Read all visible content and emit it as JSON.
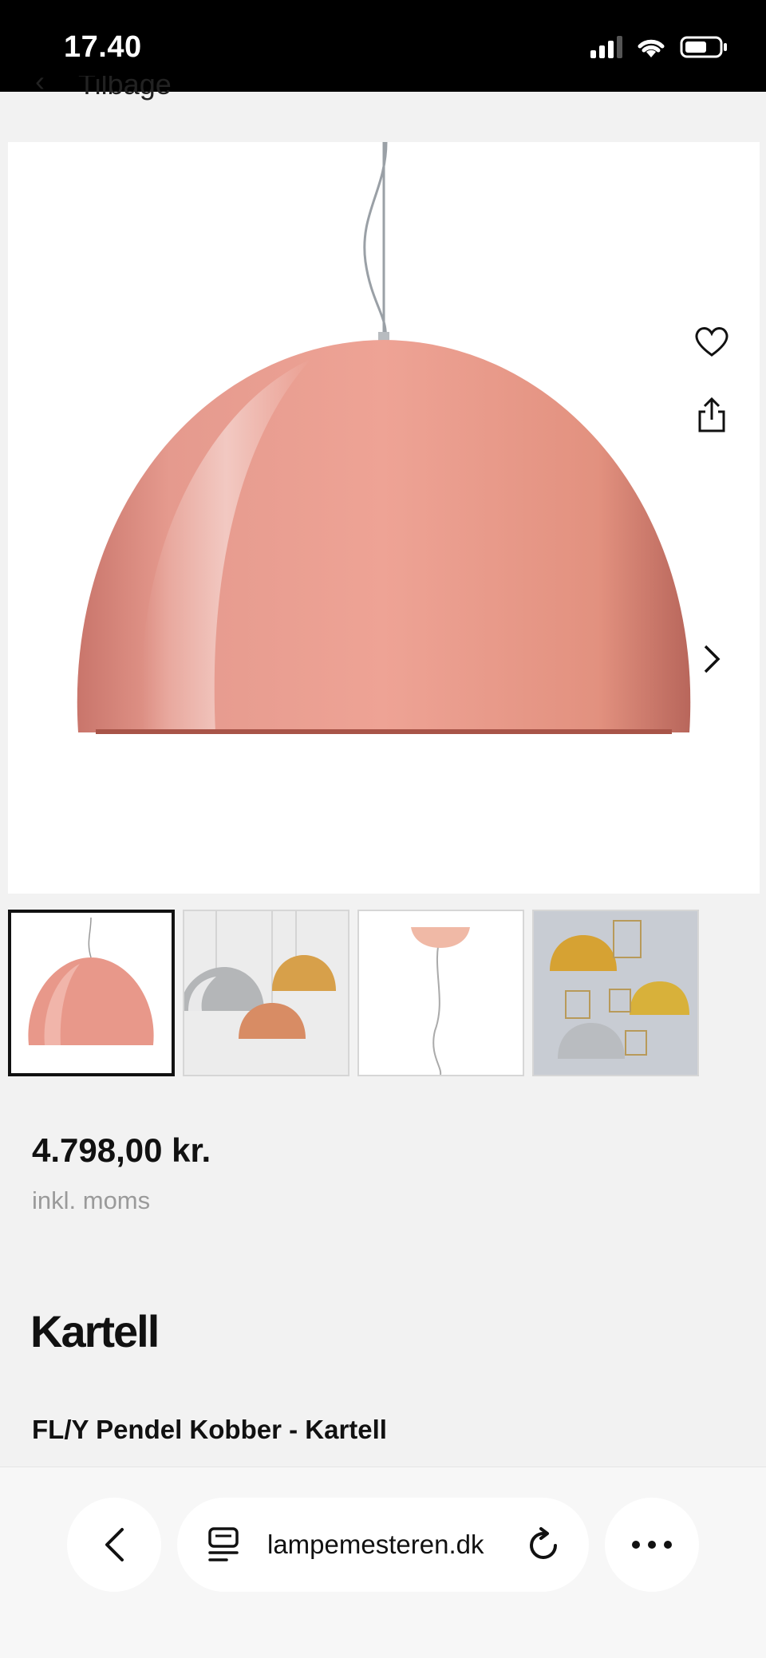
{
  "status_bar": {
    "time": "17.40",
    "icons": [
      "signal-icon",
      "wifi-icon",
      "battery-icon"
    ]
  },
  "nav": {
    "back_label": "Tilbage"
  },
  "product": {
    "price": "4.798,00 kr.",
    "vat_note": "inkl. moms",
    "brand": "Kartell",
    "title": "FL/Y Pendel Kobber - Kartell",
    "thumbnails_count": 4
  },
  "browser": {
    "url": "lampemesteren.dk"
  },
  "colors": {
    "copper": "#e89a8c",
    "accent": "#111111"
  }
}
